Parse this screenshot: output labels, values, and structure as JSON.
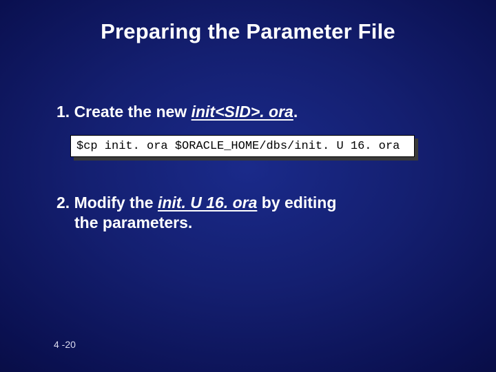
{
  "title": "Preparing the Parameter File",
  "step1": {
    "prefix": "1. Create the new ",
    "em": "init<SID>. ora",
    "suffix": "."
  },
  "code": "$cp init. ora $ORACLE_HOME/dbs/init. U 16. ora",
  "step2": {
    "line1_prefix": "2. Modify the ",
    "line1_em": "init. U 16. ora",
    "line1_suffix": " by editing",
    "line2": "the parameters."
  },
  "footer": "4 -20"
}
